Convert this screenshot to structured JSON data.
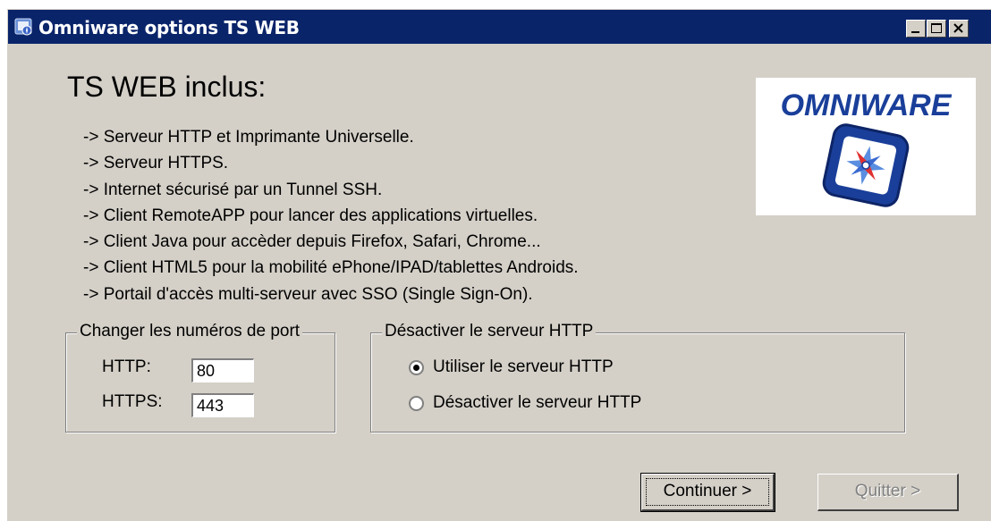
{
  "window": {
    "title": "Omniware options TS WEB",
    "controls": [
      "minimize",
      "maximize",
      "close"
    ]
  },
  "main": {
    "heading": "TS WEB inclus:",
    "features": [
      "-> Serveur HTTP et Imprimante Universelle.",
      "-> Serveur HTTPS.",
      "-> Internet sécurisé par un Tunnel SSH.",
      "-> Client RemoteAPP pour lancer des applications virtuelles.",
      "-> Client Java pour accèder depuis Firefox, Safari, Chrome...",
      "-> Client HTML5 pour la mobilité ePhone/IPAD/tablettes Androids.",
      "-> Portail d'accès multi-serveur avec SSO (Single Sign-On)."
    ],
    "logo_text": "OMNIWARE"
  },
  "ports": {
    "group_label": "Changer les numéros de port",
    "http_label": "HTTP:",
    "http_value": "80",
    "https_label": "HTTPS:",
    "https_value": "443"
  },
  "http_server": {
    "group_label": "Désactiver le serveur HTTP",
    "options": [
      {
        "label": "Utiliser le serveur HTTP",
        "selected": true
      },
      {
        "label": "Désactiver le serveur HTTP",
        "selected": false
      }
    ]
  },
  "buttons": {
    "continue_label": "Continuer >",
    "quit_label": "Quitter >"
  },
  "colors": {
    "titlebar": "#0a246a",
    "face": "#d4d0c8",
    "logo_blue": "#1a3f9a"
  }
}
